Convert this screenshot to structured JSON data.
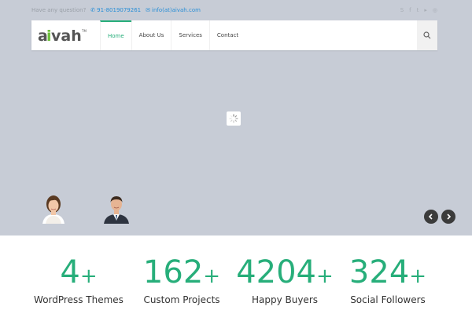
{
  "topbar": {
    "question": "Have any question?",
    "phone": "91-8019079261",
    "email": "info(at)aivah.com",
    "social_icons": [
      "skype-icon",
      "facebook-icon",
      "twitter-icon",
      "youtube-icon",
      "instagram-icon"
    ]
  },
  "brand": {
    "name": "aivah",
    "trademark": "TM",
    "accent_color": "#27ae7a",
    "logo_color": "#6dbf3b"
  },
  "nav": {
    "items": [
      {
        "label": "Home",
        "active": true
      },
      {
        "label": "About Us",
        "active": false
      },
      {
        "label": "Services",
        "active": false
      },
      {
        "label": "Contact",
        "active": false
      }
    ]
  },
  "hero": {
    "background_color": "#c7ccd6",
    "loader": "spinner-icon",
    "avatars": [
      "woman-avatar",
      "man-avatar"
    ],
    "arrows": {
      "prev": "chevron-left-icon",
      "next": "chevron-right-icon"
    }
  },
  "stats": [
    {
      "number": "4",
      "suffix": "+",
      "label": "WordPress Themes"
    },
    {
      "number": "162",
      "suffix": "+",
      "label": "Custom Projects"
    },
    {
      "number": "4204",
      "suffix": "+",
      "label": "Happy Buyers"
    },
    {
      "number": "324",
      "suffix": "+",
      "label": "Social Followers"
    }
  ]
}
